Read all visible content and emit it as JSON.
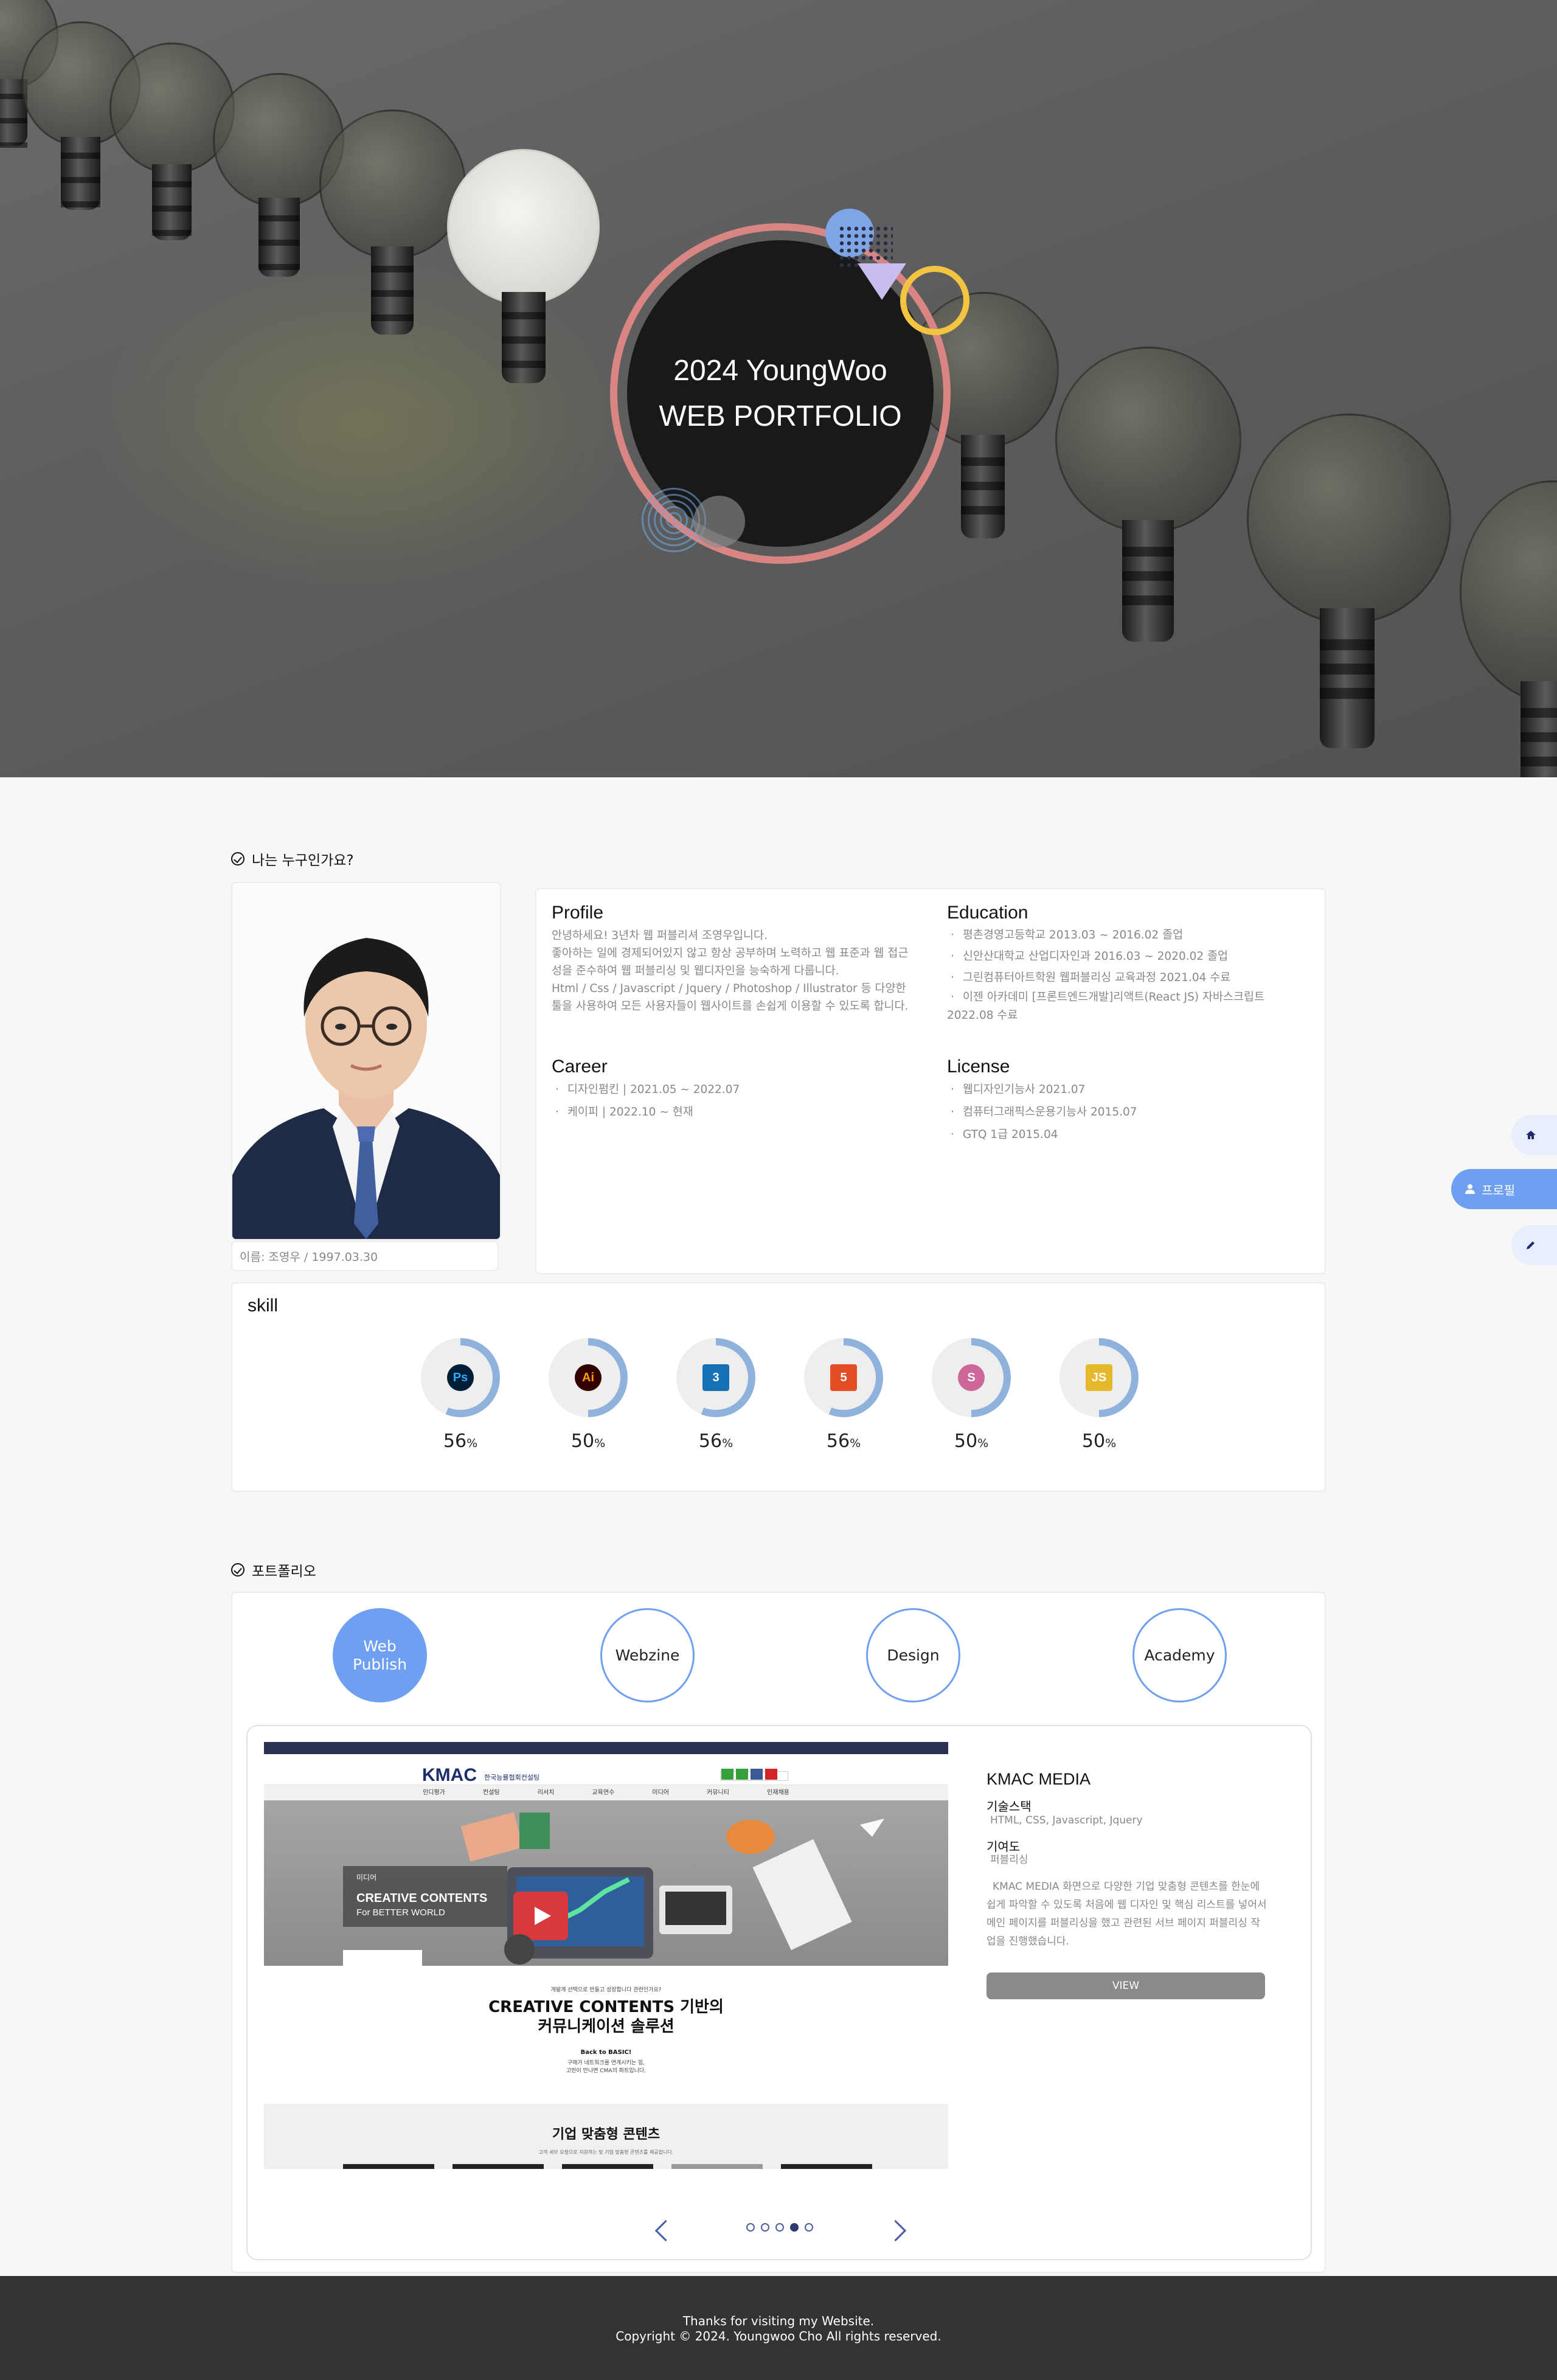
{
  "hero": {
    "title_line1": "2024 YoungWoo",
    "title_line2": "WEB PORTFOLIO"
  },
  "about": {
    "section_title": "나는 누구인가요?",
    "caption": "이름: 조영우 / 1997.03.30",
    "profile": {
      "heading": "Profile",
      "text": "안녕하세요! 3년차 웹 퍼블리셔 조영우입니다.\n좋아하는 일에 경제되어있지 않고 항상 공부하며 노력하고 웹 표준과 웹 접근성을 준수하여 웹 퍼블리싱 및 웹디자인을 능숙하게 다룹니다.\nHtml / Css / Javascript / Jquery / Photoshop / Illustrator 등 다양한 툴을 사용하여 모든 사용자들이 웹사이트를 손쉽게 이용할 수 있도록 합니다."
    },
    "education": {
      "heading": "Education",
      "items": [
        "평촌경영고등학교 2013.03 ~ 2016.02 졸업",
        "신안산대학교 산업디자인과 2016.03 ~ 2020.02 졸업",
        "그린컴퓨터아트학원 웹퍼블리싱 교육과정 2021.04 수료",
        "이젠 아카데미 [프론트엔드개발]리액트(React JS) 자바스크립트 2022.08 수료"
      ]
    },
    "career": {
      "heading": "Career",
      "items": [
        "디자인펌킨 | 2021.05 ~ 2022.07",
        "케이피 | 2022.10 ~ 현재"
      ]
    },
    "license": {
      "heading": "License",
      "items": [
        "웹디자인기능사 2021.07",
        "컴퓨터그래픽스운용기능사 2015.07",
        "GTQ 1급 2015.04"
      ]
    }
  },
  "skill": {
    "heading": "skill",
    "unit": "%",
    "items": [
      {
        "icon": "photoshop-icon",
        "label": "Ps",
        "value": "56",
        "level": 0.56,
        "color": "#31a8ff",
        "bg": "#001e36"
      },
      {
        "icon": "illustrator-icon",
        "label": "Ai",
        "value": "50",
        "level": 0.5,
        "color": "#ff9a00",
        "bg": "#330000"
      },
      {
        "icon": "css3-icon",
        "label": "3",
        "value": "56",
        "level": 0.56,
        "color": "#ffffff",
        "bg": "#1572b6"
      },
      {
        "icon": "html5-icon",
        "label": "5",
        "value": "56",
        "level": 0.56,
        "color": "#ffffff",
        "bg": "#e44d26"
      },
      {
        "icon": "sass-icon",
        "label": "S",
        "value": "50",
        "level": 0.5,
        "color": "#ffffff",
        "bg": "#cd6799"
      },
      {
        "icon": "javascript-icon",
        "label": "JS",
        "value": "50",
        "level": 0.5,
        "color": "#ffffff",
        "bg": "#e6b82c"
      }
    ],
    "ring_color": "#8fb2dc",
    "ring_track": "#eeeeee"
  },
  "portfolio": {
    "section_title": "포트폴리오",
    "tabs": [
      "Web\nPublish",
      "Webzine",
      "Design",
      "Academy"
    ],
    "active_tab": 0,
    "mock": {
      "logo": "KMAC",
      "logo_sub": "한국능률협회컨설팅",
      "nav": [
        "인디평가",
        "컨설팅",
        "리서치",
        "교육연수",
        "미디어",
        "커뮤니티",
        "인재채용"
      ],
      "badge": "미디어",
      "visual_line1": "CREATIVE CONTENTS",
      "visual_line2": "For BETTER WORLD",
      "intro_small": "개발계 선택으로 만들고 성장합니다 관련인가요?",
      "headline1": "CREATIVE CONTENTS 기반의",
      "headline2": "커뮤니케이션 솔루션",
      "back": "Back to BASIC!",
      "desc": "구매가 네트워크를 연계시키는 힘,\n고민이 만나면 CMA의 파트입니다.",
      "lower_title": "기업 맞춤형 콘텐츠",
      "lower_sub": "고객 세부 요청으로 지원하는 맞 기업 맞춤형 콘텐츠를 제공합니다."
    },
    "project": {
      "title": "KMAC MEDIA",
      "stack_label": "기술스택",
      "stack": "HTML, CSS, Javascript, Jquery",
      "contrib_label": "기여도",
      "contrib": "퍼블리싱",
      "desc": "KMAC MEDIA 화면으로 다양한 기업 맞춤형 콘텐츠를 한눈에 쉽게 파악할 수 있도록 처음에 웹 디자인 및 핵심 리스트를 넣어서 메인 페이지를 퍼블리싱을 했고 관련된 서브 페이지 퍼블리싱 작업을 진행했습니다.",
      "button": "VIEW"
    },
    "pager": {
      "count": 5,
      "active": 3
    }
  },
  "side_nav": {
    "profile_label": "프로필"
  },
  "footer": {
    "line1": "Thanks for visiting my Website.",
    "line2": "Copyright © 2024. Youngwoo Cho All rights reserved."
  }
}
